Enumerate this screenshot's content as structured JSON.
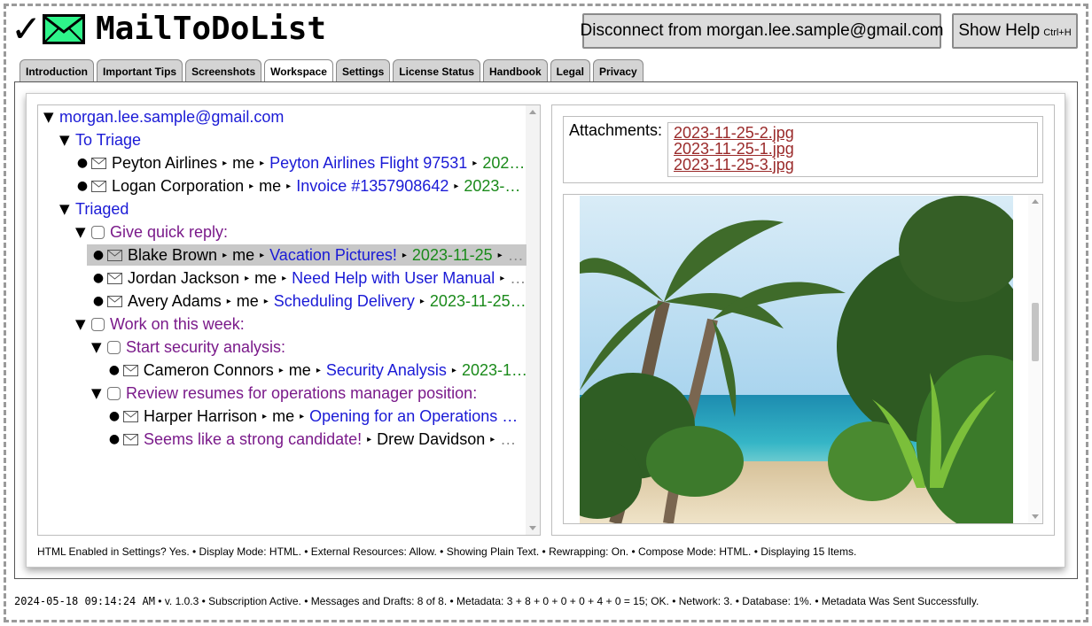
{
  "app": {
    "title": "MailToDoList",
    "disconnect_label": "Disconnect from morgan.lee.sample@gmail.com",
    "help_label": "Show Help",
    "help_shortcut": "Ctrl+H"
  },
  "tabs": [
    {
      "label": "Introduction",
      "active": false
    },
    {
      "label": "Important Tips",
      "active": false
    },
    {
      "label": "Screenshots",
      "active": false
    },
    {
      "label": "Workspace",
      "active": true
    },
    {
      "label": "Settings",
      "active": false
    },
    {
      "label": "License Status",
      "active": false
    },
    {
      "label": "Handbook",
      "active": false
    },
    {
      "label": "Legal",
      "active": false
    },
    {
      "label": "Privacy",
      "active": false
    }
  ],
  "tree": {
    "account": "morgan.lee.sample@gmail.com",
    "to_triage_label": "To Triage",
    "to_triage": [
      {
        "from": "Peyton Airlines",
        "to": "me",
        "subject": "Peyton Airlines Flight 97531",
        "date": "202…"
      },
      {
        "from": "Logan Corporation",
        "to": "me",
        "subject": "Invoice #1357908642",
        "date": "2023-…"
      }
    ],
    "triaged_label": "Triaged",
    "quick_reply_label": "Give quick reply:",
    "quick_reply": [
      {
        "from": "Blake Brown",
        "to": "me",
        "subject": "Vacation Pictures!",
        "date": "2023-11-25",
        "more": "…",
        "selected": true
      },
      {
        "from": "Jordan Jackson",
        "to": "me",
        "subject": "Need Help with User Manual",
        "more": "…"
      },
      {
        "from": "Avery Adams",
        "to": "me",
        "subject": "Scheduling Delivery",
        "date": "2023-11-25…"
      }
    ],
    "this_week_label": "Work on this week:",
    "security_label": "Start security analysis:",
    "security": [
      {
        "from": "Cameron Connors",
        "to": "me",
        "subject": "Security Analysis",
        "date": "2023-1…"
      }
    ],
    "resumes_label": "Review resumes for operations manager position:",
    "resumes": [
      {
        "from": "Harper Harrison",
        "to": "me",
        "subject": "Opening for an Operations …"
      },
      {
        "note": "Seems like a strong candidate!",
        "from": "Drew Davidson",
        "more": "…"
      }
    ]
  },
  "attachments": {
    "label": "Attachments:",
    "files": [
      "2023-11-25-2.jpg",
      "2023-11-25-1.jpg",
      "2023-11-25-3.jpg"
    ]
  },
  "status_line": "HTML Enabled in Settings? Yes.  •  Display Mode: HTML.  •  External Resources: Allow.  •  Showing Plain Text.  •  Rewrapping: On.  •  Compose Mode: HTML.  •  Displaying 15 Items.",
  "footer": {
    "timestamp": "2024-05-18 09:14:24 AM",
    "rest": " •  v. 1.0.3  •  Subscription Active.  •  Messages and Drafts: 8 of 8.  •  Metadata: 3 + 8 + 0 + 0 + 0 + 4 + 0 = 15; OK.  •  Network: 3.  •  Database: 1%.  •  Metadata Was Sent Successfully."
  },
  "glyphs": {
    "arrow": "▸",
    "expanded": "▼",
    "bullet": "●",
    "check": "✓"
  },
  "colors": {
    "link": "#1a1ad6",
    "note": "#7a1a8a",
    "date": "#1a8a1a",
    "attachment": "#9a2a2a",
    "envelope_fill": "#2ef58a"
  }
}
